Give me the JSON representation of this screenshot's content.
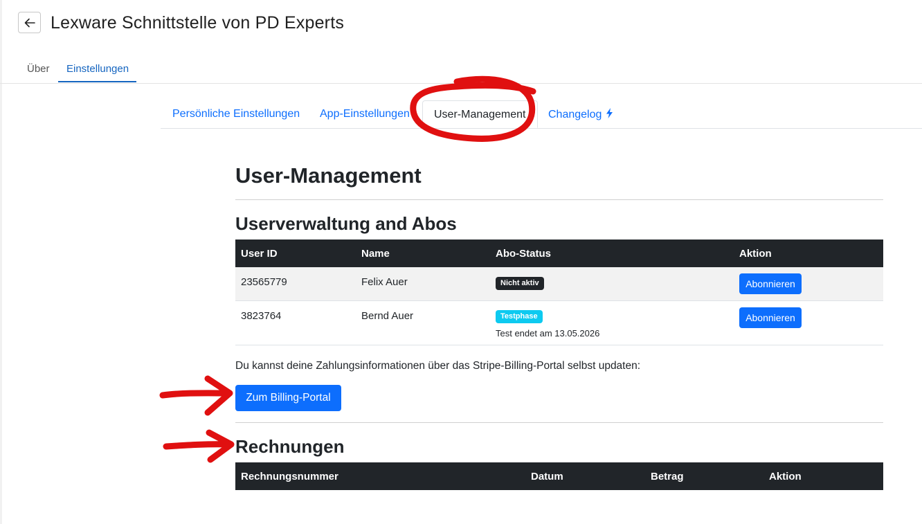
{
  "app": {
    "title": "Lexware Schnittstelle von PD Experts",
    "back_icon": "arrow-left-icon"
  },
  "main_tabs": [
    {
      "label": "Über",
      "active": false
    },
    {
      "label": "Einstellungen",
      "active": true
    }
  ],
  "sub_tabs": [
    {
      "label": "Persönliche Einstellungen",
      "active": false
    },
    {
      "label": "App-Einstellungen",
      "active": false
    },
    {
      "label": "User-Management",
      "active": true
    },
    {
      "label": "Changelog",
      "active": false,
      "icon": "lightning-bolt-icon"
    }
  ],
  "page": {
    "heading": "User-Management",
    "section_users": "Userverwaltung and Abos",
    "users_table": {
      "headers": [
        "User ID",
        "Name",
        "Abo-Status",
        "Aktion"
      ],
      "rows": [
        {
          "user_id": "23565779",
          "name": "Felix Auer",
          "status": "Nicht aktiv",
          "status_note": "",
          "action": "Abonnieren"
        },
        {
          "user_id": "3823764",
          "name": "Bernd Auer",
          "status": "Testphase",
          "status_note": "Test endet am 13.05.2026",
          "action": "Abonnieren"
        }
      ]
    },
    "billing_info": "Du kannst deine Zahlungsinformationen über das Stripe-Billing-Portal selbst updaten:",
    "billing_button": "Zum Billing-Portal",
    "section_invoices": "Rechnungen",
    "invoices_table": {
      "headers": [
        "Rechnungsnummer",
        "Datum",
        "Betrag",
        "Aktion"
      ]
    }
  },
  "colors": {
    "accent": "#0d6efd",
    "header_dark": "#212529",
    "badge_info": "#0dcaf0",
    "annotation_red": "#e01010"
  }
}
